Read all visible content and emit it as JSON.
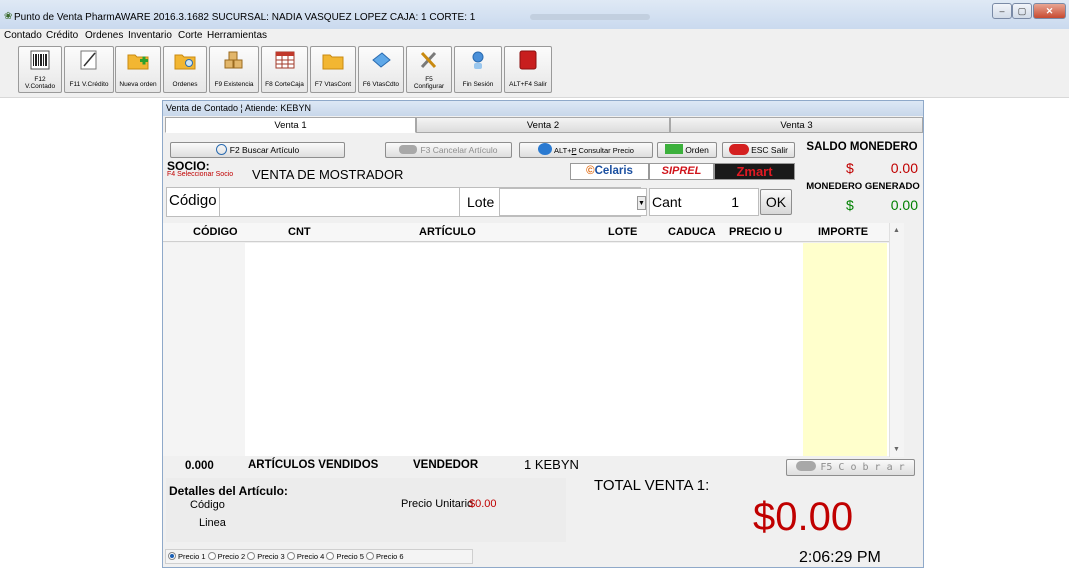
{
  "window": {
    "title": "Punto de Venta PharmAWARE 2016.3.1682 SUCURSAL: NADIA VASQUEZ LOPEZ CAJA: 1  CORTE: 1",
    "minimize": "–",
    "maximize": "▢",
    "close": "✕"
  },
  "menu": [
    "Contado",
    "Crédito",
    "Ordenes",
    "Inventario",
    "Corte",
    "Herramientas"
  ],
  "toolbar": [
    {
      "label": "F12\nV.Contado",
      "icon": "barcode-icon"
    },
    {
      "label": "F11 V.Crédito",
      "icon": "pencil-icon"
    },
    {
      "label": "Nueva orden",
      "icon": "new-folder-icon"
    },
    {
      "label": "Ordenes",
      "icon": "folder-search-icon"
    },
    {
      "label": "F9 Existencia",
      "icon": "boxes-icon"
    },
    {
      "label": "F8 CorteCaja",
      "icon": "calendar-icon"
    },
    {
      "label": "F7 VtasCont",
      "icon": "folder-icon"
    },
    {
      "label": "F6 VtasCdto",
      "icon": "card-icon"
    },
    {
      "label": "F5\nConfigurar",
      "icon": "tools-icon"
    },
    {
      "label": "Fin Sesión",
      "icon": "user-logout-icon"
    },
    {
      "label": "ALT+F4 Salir",
      "icon": "exit-icon"
    }
  ],
  "panel": {
    "header": "Venta de Contado ¦ Atiende: KEBYN",
    "tabs": [
      "Venta 1",
      "Venta 2",
      "Venta 3"
    ],
    "buscar": "F2 Buscar Artículo",
    "cancelar": "F3 Cancelar Artículo",
    "consultar_prefix": "ALT+",
    "consultar_key": "P",
    "consultar_suffix": "  Consultar Precio",
    "orden": "Orden",
    "salir": "ESC Salir",
    "saldo_title": "SALDO MONEDERO",
    "saldo_currency": "$",
    "saldo_value": "0.00",
    "generado_title": "MONEDERO GENERADO",
    "generado_currency": "$",
    "generado_value": "0.00",
    "socio_label": "SOCIO:",
    "socio_hint": "F4 Seleccionar Socio",
    "socio_value": "VENTA DE MOSTRADOR",
    "logos": {
      "celaris": "Celaris",
      "siprel": "SIPREL",
      "zmart": "Zmart"
    },
    "codigo_label": "Código",
    "lote_label": "Lote",
    "cant_label": "Cant",
    "cant_value": "1",
    "ok": "OK",
    "columns": [
      "CÓDIGO",
      "CNT",
      "ARTÍCULO",
      "LOTE",
      "CADUCA",
      "PRECIO U",
      "IMPORTE"
    ],
    "rows": [],
    "articulos_count": "0.000",
    "articulos_label": "ARTÍCULOS VENDIDOS",
    "vendedor_label": "VENDEDOR",
    "vendedor_value": "1  KEBYN",
    "cobrar": "F5  C o b r a r",
    "detalles_title": "Detalles del Artículo:",
    "det_codigo": "Código",
    "det_linea": "Linea",
    "precio_unitario_label": "Precio Unitario",
    "precio_unitario_value": "$0.00",
    "total_label": "TOTAL VENTA 1:",
    "total_value": "$0.00",
    "precios": [
      "Precio 1",
      "Precio 2",
      "Precio 3",
      "Precio 4",
      "Precio 5",
      "Precio 6"
    ],
    "precio_selected": "Precio 1",
    "clock": "2:06:29 PM"
  },
  "colors": {
    "money_red": "#c00000",
    "money_green": "#008000",
    "importe_bg": "#ffffcc",
    "celaris_orange": "#e06a10",
    "siprel_red": "#d0141b",
    "zmart_red": "#e21a23"
  }
}
